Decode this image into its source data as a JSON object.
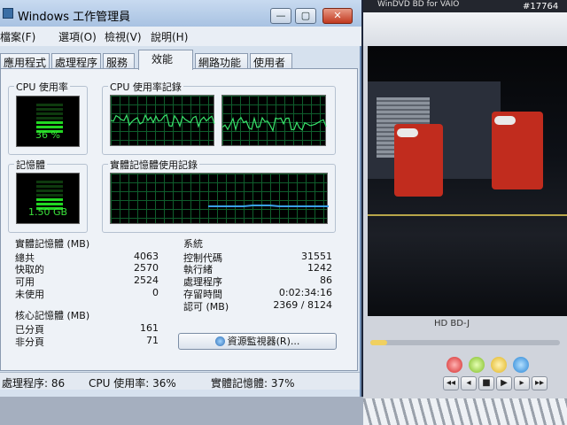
{
  "window": {
    "title": "Windows 工作管理員",
    "minimize": "—",
    "maximize": "▢",
    "close": "✕"
  },
  "menu": [
    "檔案(F)",
    "選項(O)",
    "檢視(V)",
    "說明(H)"
  ],
  "tabs": [
    "應用程式",
    "處理程序",
    "服務",
    "效能",
    "網路功能",
    "使用者"
  ],
  "active_tab": "效能",
  "cpu": {
    "usage_label": "CPU 使用率",
    "usage_value": "36 %",
    "usage_percent": 36,
    "history_label": "CPU 使用率記錄"
  },
  "memory": {
    "label": "記憶體",
    "value": "1.50 GB",
    "fill_fraction": 0.37,
    "history_label": "實體記憶體使用記錄"
  },
  "physical_memory": {
    "title": "實體記憶體 (MB)",
    "rows": [
      {
        "key": "總共",
        "value": "4063"
      },
      {
        "key": "快取的",
        "value": "2570"
      },
      {
        "key": "可用",
        "value": "2524"
      },
      {
        "key": "未使用",
        "value": "0"
      }
    ]
  },
  "kernel_memory": {
    "title": "核心記憶體 (MB)",
    "rows": [
      {
        "key": "已分頁",
        "value": "161"
      },
      {
        "key": "非分頁",
        "value": "71"
      }
    ]
  },
  "system": {
    "title": "系統",
    "rows": [
      {
        "key": "控制代碼",
        "value": "31551"
      },
      {
        "key": "執行緒",
        "value": "1242"
      },
      {
        "key": "處理程序",
        "value": "86"
      },
      {
        "key": "存留時間",
        "value": "0:02:34:16"
      },
      {
        "key": "認可 (MB)",
        "value": "2369 / 8124"
      }
    ]
  },
  "resource_monitor_button": "資源監視器(R)...",
  "statusbar": {
    "processes": "處理程序: 86",
    "cpu": "CPU 使用率: 36%",
    "memory": "實體記憶體: 37%"
  },
  "player": {
    "title": "WinDVD BD for VAIO",
    "badges": "HD  BD-J",
    "seek_fraction": 0.09,
    "controls": [
      "◂◂",
      "◂",
      "■",
      "▶",
      "▸",
      "▸▸",
      "▮▮",
      "⏏"
    ]
  },
  "watermark": "#17764",
  "colors": {
    "graph_line": "#39e36b",
    "memory_line": "#3aa0e8",
    "grid": "#0f5d2c"
  }
}
